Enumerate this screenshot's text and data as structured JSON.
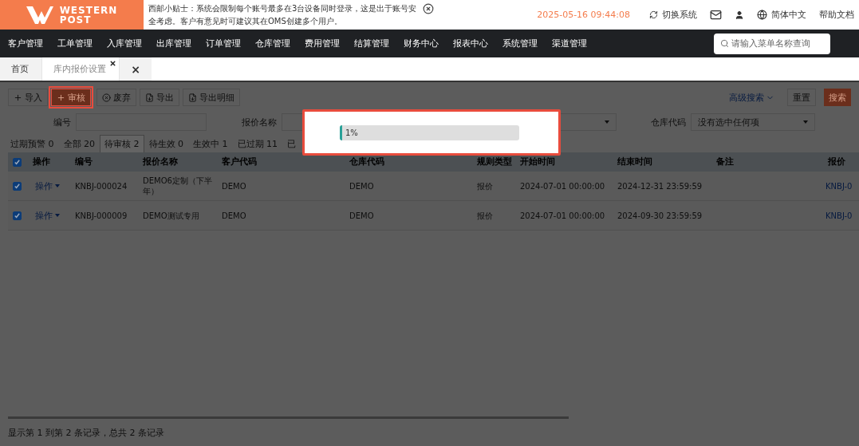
{
  "header": {
    "logo_line1": "WESTERN",
    "logo_line2": "POST",
    "notice": "西邮小贴士：系统会限制每个账号最多在3台设备同时登录，这是出于账号安全考虑。客户有意见时可建议其在OMS创建多个用户。",
    "datetime": "2025-05-16 09:44:08",
    "switch_system": "切换系统",
    "language": "简体中文",
    "help": "帮助文档"
  },
  "nav": {
    "items": [
      "客户管理",
      "工单管理",
      "入库管理",
      "出库管理",
      "订单管理",
      "仓库管理",
      "费用管理",
      "结算管理",
      "财务中心",
      "报表中心",
      "系统管理",
      "渠道管理"
    ],
    "search_placeholder": "请输入菜单名称查询"
  },
  "page_tabs": [
    {
      "label": "首页",
      "selected": false,
      "closable": false
    },
    {
      "label": "库内报价设置",
      "selected": true,
      "closable": true
    }
  ],
  "close_all": "×",
  "toolbar": {
    "buttons": [
      {
        "label": "导入",
        "highlighted": false
      },
      {
        "label": "审核",
        "highlighted": true
      },
      {
        "label": "废弃",
        "highlighted": false
      },
      {
        "label": "导出",
        "highlighted": false
      },
      {
        "label": "导出明细",
        "highlighted": false
      }
    ],
    "advanced_search": "高级搜索",
    "reset": "重置",
    "search": "搜索"
  },
  "filters": [
    {
      "label": "编号",
      "kind": "input"
    },
    {
      "label": "报价名称",
      "kind": "select"
    },
    {
      "label": "仓库代码",
      "kind": "select",
      "value": "没有选中任何项"
    }
  ],
  "status_tabs": [
    {
      "label": "过期预警 0",
      "selected": false
    },
    {
      "label": "全部 20",
      "selected": false
    },
    {
      "label": "待审核 2",
      "selected": true
    },
    {
      "label": "待生效 0",
      "selected": false
    },
    {
      "label": "生效中 1",
      "selected": false
    },
    {
      "label": "已过期 11",
      "selected": false
    },
    {
      "label": "已",
      "selected": false
    }
  ],
  "table": {
    "all_checked": true,
    "columns": [
      "操作",
      "编号",
      "报价名称",
      "客户代码",
      "仓库代码",
      "规则类型",
      "开始时间",
      "结束时间",
      "备注",
      "报价"
    ],
    "rows": [
      {
        "checked": true,
        "cells": [
          "操作",
          "KNBJ-000024",
          "DEMO6定制（下半年）",
          "DEMO",
          "DEMO",
          "报价",
          "2024-07-01 00:00:00",
          "2024-12-31 23:59:59",
          "",
          "KNBJ-0"
        ]
      },
      {
        "checked": true,
        "cells": [
          "操作",
          "KNBJ-000009",
          "DEMO测试专用",
          "DEMO",
          "DEMO",
          "报价",
          "2024-07-01 00:00:00",
          "2024-09-30 23:59:59",
          "",
          "KNBJ-0"
        ]
      }
    ]
  },
  "footer": "显示第 1 到第 2 条记录，总共 2 条记录",
  "progress_dialog": {
    "highlighted": true,
    "level": 0.01,
    "reading": "1%"
  }
}
